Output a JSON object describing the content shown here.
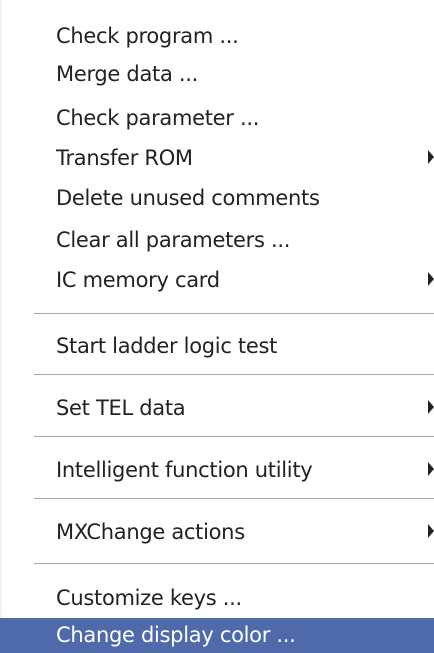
{
  "menu": {
    "items": [
      {
        "label": "Check program ..."
      },
      {
        "label": "Merge data ..."
      },
      {
        "label": "Check parameter ..."
      },
      {
        "label": "Transfer ROM"
      },
      {
        "label": "Delete unused comments"
      },
      {
        "label": "Clear all parameters ..."
      },
      {
        "label": "IC memory card"
      },
      {
        "label": "Start ladder logic test"
      },
      {
        "label": "Set TEL data"
      },
      {
        "label": "Intelligent function utility"
      },
      {
        "label": "MXChange actions"
      },
      {
        "label": "Customize keys ..."
      },
      {
        "label": "Change display color ..."
      }
    ],
    "submenu_arrow_icon": "chevron-right-icon",
    "colors": {
      "highlight_background": "#4e6aaa",
      "highlight_text": "#ffffff",
      "text": "#222222",
      "separator": "#a9a9a9"
    }
  }
}
